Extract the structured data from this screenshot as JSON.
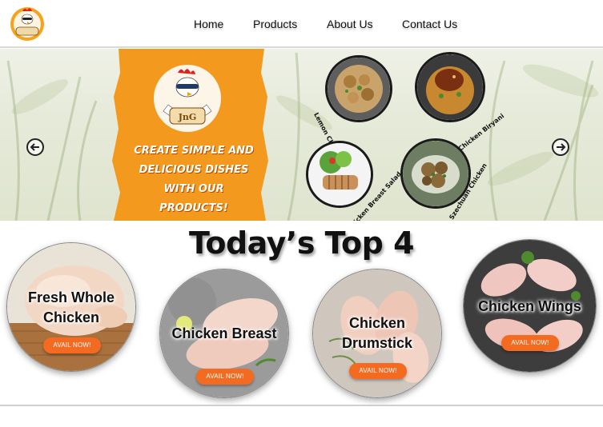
{
  "header": {
    "logo_alt": "JnG",
    "nav": [
      {
        "label": "Home"
      },
      {
        "label": "Products"
      },
      {
        "label": "About Us"
      },
      {
        "label": "Contact Us"
      }
    ]
  },
  "banner": {
    "tagline_lines": [
      "CREATE SIMPLE AND",
      "DELICIOUS DISHES",
      "WITH OUR PRODUCTS!"
    ],
    "logo_text": "JnG",
    "dishes": [
      {
        "label": "Lemon Chicken"
      },
      {
        "label": "Chicken Biryani"
      },
      {
        "label": "Chicken Breast Salad"
      },
      {
        "label": "Szechuan Chicken"
      }
    ]
  },
  "top4": {
    "title": "Today’s Top 4",
    "products": [
      {
        "name_lines": [
          "Fresh Whole",
          "Chicken"
        ],
        "button": "AVAIL NOW!"
      },
      {
        "name_lines": [
          "Chicken Breast"
        ],
        "button": "AVAIL NOW!"
      },
      {
        "name_lines": [
          "Chicken",
          "Drumstick"
        ],
        "button": "AVAIL NOW!"
      },
      {
        "name_lines": [
          "Chicken Wings"
        ],
        "button": "AVAIL NOW!"
      }
    ]
  },
  "colors": {
    "accent_orange": "#f26b21",
    "banner_orange": "#f39a1e",
    "nav_text": "#111111"
  }
}
